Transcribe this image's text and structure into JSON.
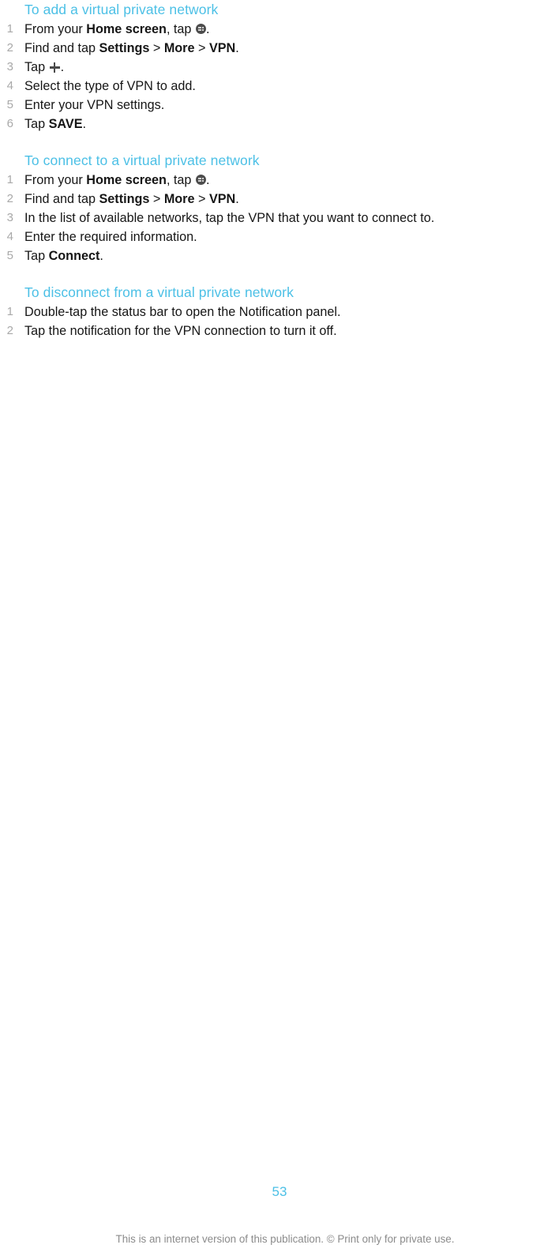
{
  "page": {
    "number": "53",
    "footer_note": "This is an internet version of this publication. © Print only for private use.",
    "heading_color": "#4cc0e6",
    "number_color": "#a9a9a9",
    "body_color": "#161616",
    "footer_color": "#8b8b8b",
    "background": "#ffffff"
  },
  "sections": [
    {
      "heading": "To add a virtual private network",
      "steps": [
        {
          "num": "1",
          "parts": [
            {
              "type": "text",
              "text": "From your "
            },
            {
              "type": "bold",
              "text": "Home screen"
            },
            {
              "type": "text",
              "text": ", tap "
            },
            {
              "type": "icon",
              "icon": "app-drawer-icon"
            },
            {
              "type": "text",
              "text": "."
            }
          ]
        },
        {
          "num": "2",
          "parts": [
            {
              "type": "text",
              "text": "Find and tap "
            },
            {
              "type": "bold",
              "text": "Settings"
            },
            {
              "type": "text",
              "text": " > "
            },
            {
              "type": "bold",
              "text": "More"
            },
            {
              "type": "text",
              "text": " > "
            },
            {
              "type": "bold",
              "text": "VPN"
            },
            {
              "type": "text",
              "text": "."
            }
          ]
        },
        {
          "num": "3",
          "parts": [
            {
              "type": "text",
              "text": "Tap "
            },
            {
              "type": "icon",
              "icon": "plus-icon"
            },
            {
              "type": "text",
              "text": "."
            }
          ]
        },
        {
          "num": "4",
          "parts": [
            {
              "type": "text",
              "text": "Select the type of VPN to add."
            }
          ]
        },
        {
          "num": "5",
          "parts": [
            {
              "type": "text",
              "text": "Enter your VPN settings."
            }
          ]
        },
        {
          "num": "6",
          "parts": [
            {
              "type": "text",
              "text": "Tap "
            },
            {
              "type": "bold",
              "text": "SAVE"
            },
            {
              "type": "text",
              "text": "."
            }
          ]
        }
      ]
    },
    {
      "heading": "To connect to a virtual private network",
      "steps": [
        {
          "num": "1",
          "parts": [
            {
              "type": "text",
              "text": "From your "
            },
            {
              "type": "bold",
              "text": "Home screen"
            },
            {
              "type": "text",
              "text": ", tap "
            },
            {
              "type": "icon",
              "icon": "app-drawer-icon"
            },
            {
              "type": "text",
              "text": "."
            }
          ]
        },
        {
          "num": "2",
          "parts": [
            {
              "type": "text",
              "text": "Find and tap "
            },
            {
              "type": "bold",
              "text": "Settings"
            },
            {
              "type": "text",
              "text": " > "
            },
            {
              "type": "bold",
              "text": "More"
            },
            {
              "type": "text",
              "text": " > "
            },
            {
              "type": "bold",
              "text": "VPN"
            },
            {
              "type": "text",
              "text": "."
            }
          ]
        },
        {
          "num": "3",
          "parts": [
            {
              "type": "text",
              "text": "In the list of available networks, tap the VPN that you want to connect to."
            }
          ]
        },
        {
          "num": "4",
          "parts": [
            {
              "type": "text",
              "text": "Enter the required information."
            }
          ]
        },
        {
          "num": "5",
          "parts": [
            {
              "type": "text",
              "text": "Tap "
            },
            {
              "type": "bold",
              "text": "Connect"
            },
            {
              "type": "text",
              "text": "."
            }
          ]
        }
      ]
    },
    {
      "heading": "To disconnect from a virtual private network",
      "steps": [
        {
          "num": "1",
          "parts": [
            {
              "type": "text",
              "text": "Double-tap the status bar to open the Notification panel."
            }
          ]
        },
        {
          "num": "2",
          "parts": [
            {
              "type": "text",
              "text": "Tap the notification for the VPN connection to turn it off."
            }
          ]
        }
      ]
    }
  ]
}
